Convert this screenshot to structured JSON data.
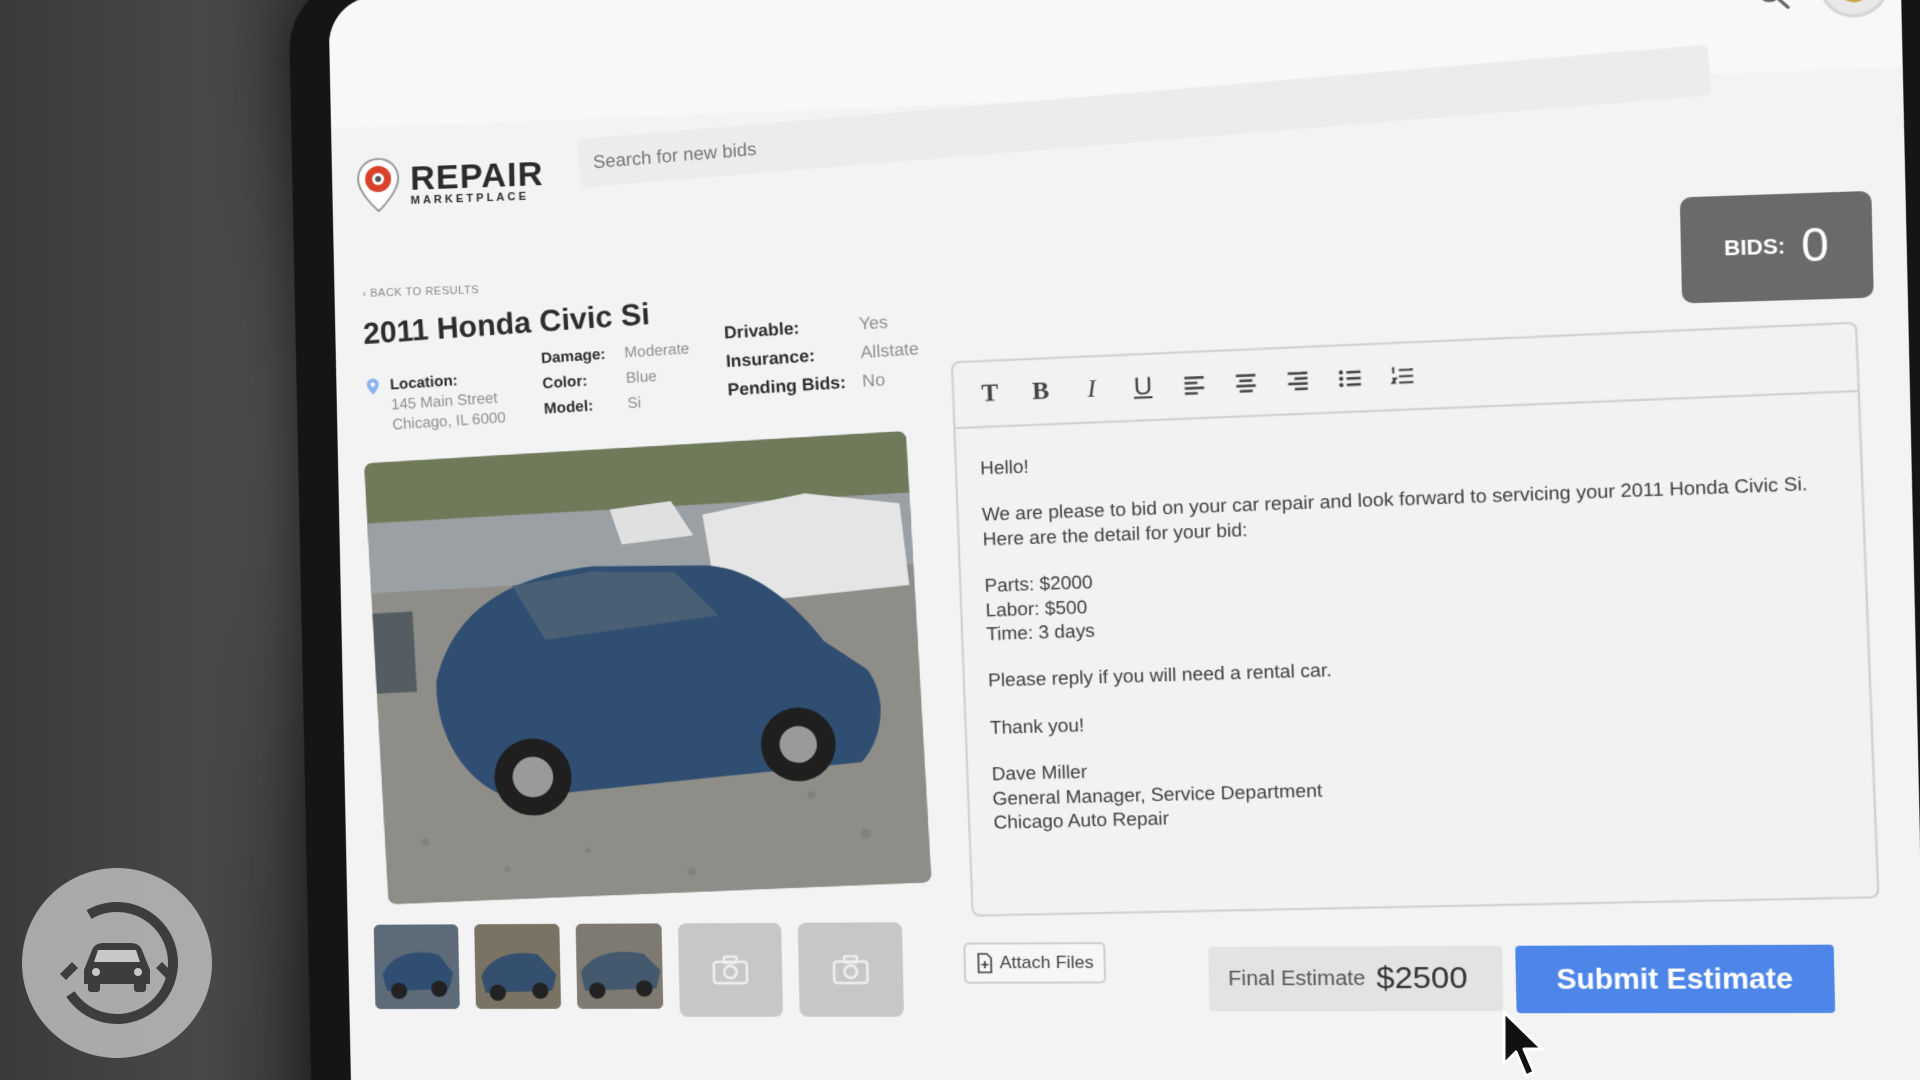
{
  "brand": {
    "title": "REPAIR",
    "subtitle": "MARKETPLACE"
  },
  "search": {
    "placeholder": "Search for new bids"
  },
  "nav": {
    "back_label": "‹ BACK TO RESULTS"
  },
  "listing": {
    "title": "2011 Honda Civic Si",
    "location_label": "Location:",
    "address_line1": "145 Main Street",
    "address_line2": "Chicago, IL 6000",
    "damage_label": "Damage:",
    "damage": "Moderate",
    "color_label": "Color:",
    "color": "Blue",
    "model_label": "Model:",
    "model": "Si",
    "drivable_label": "Drivable:",
    "drivable": "Yes",
    "insurance_label": "Insurance:",
    "insurance": "Allstate",
    "pending_label": "Pending Bids:",
    "pending": "No"
  },
  "bids": {
    "label": "BIDS:",
    "count": "0"
  },
  "editor": {
    "toolbar": [
      "T",
      "B",
      "I",
      "U"
    ],
    "greeting": "Hello!",
    "intro": "We are please to bid on your car repair and look forward to servicing your 2011 Honda Civic Si. Here are the detail for your bid:",
    "parts": "Parts: $2000",
    "labor": "Labor: $500",
    "time": "Time: 3 days",
    "rental": "Please reply if you will need a rental car.",
    "thanks": "Thank you!",
    "sig_name": "Dave Miller",
    "sig_title": "General Manager, Service Department",
    "sig_company": "Chicago Auto Repair"
  },
  "actions": {
    "attach_label": "Attach Files",
    "final_label": "Final Estimate",
    "final_value": "$2500",
    "submit_label": "Submit Estimate"
  },
  "colors": {
    "accent": "#4d85e8",
    "logo_red": "#d9412b",
    "bids_bg": "#6a6a6a"
  }
}
